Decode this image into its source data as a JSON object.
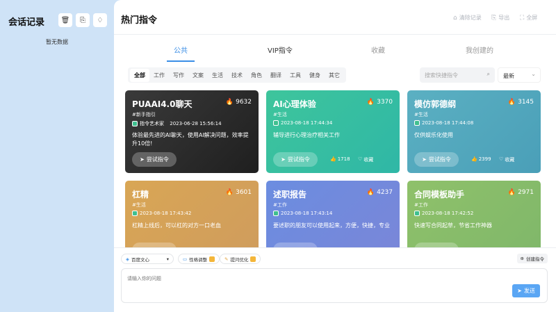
{
  "sidebar": {
    "title": "会话记录",
    "empty": "暂无数据",
    "btn1_icon": "trash-icon",
    "btn2_icon": "export-icon",
    "btn3_icon": "bulb-icon"
  },
  "header": {
    "title": "热门指令",
    "clear": "清除记录",
    "export": "导出",
    "fullscreen": "全屏"
  },
  "tabs": [
    {
      "label": "公共"
    },
    {
      "label": "VIP指令"
    },
    {
      "label": "收藏"
    },
    {
      "label": "我创建的"
    }
  ],
  "filters": [
    "全部",
    "工作",
    "写作",
    "文案",
    "生活",
    "技术",
    "角色",
    "翻译",
    "工具",
    "健身",
    "其它"
  ],
  "search": {
    "placeholder": "搜索快捷指令"
  },
  "sort": {
    "value": "最新"
  },
  "cards": [
    {
      "title": "PUAAI4.0聊天",
      "views": "9632",
      "tag": "#新手指引",
      "author": "指令艺术家",
      "date": "2023-06-28 15:56:14",
      "desc": "体验最先进的AI聊天，使用AI解决问题，效率提升10倍!",
      "try": "尝试指令",
      "likes": "",
      "fav": ""
    },
    {
      "title": "AI心理体验",
      "views": "3370",
      "tag": "#生活",
      "author": "",
      "date": "2023-08-18 17:44:34",
      "desc": "辅导进行心理治疗相关工作",
      "try": "尝试指令",
      "likes": "1718",
      "fav": "收藏"
    },
    {
      "title": "模仿郭德纲",
      "views": "3145",
      "tag": "#生活",
      "author": "",
      "date": "2023-08-18 17:44:08",
      "desc": "仅供娱乐化使用",
      "try": "尝试指令",
      "likes": "2399",
      "fav": "收藏"
    },
    {
      "title": "杠精",
      "views": "3601",
      "tag": "#生活",
      "author": "",
      "date": "2023-08-18 17:43:42",
      "desc": "杠精上线后，可以杠的对方一口老血",
      "try": "",
      "likes": "",
      "fav": ""
    },
    {
      "title": "述职报告",
      "views": "4237",
      "tag": "#工作",
      "author": "",
      "date": "2023-08-18 17:43:14",
      "desc": "要述职的朋友可以使用起来，方便，快捷，专业",
      "try": "",
      "likes": "",
      "fav": ""
    },
    {
      "title": "合同模板助手",
      "views": "2971",
      "tag": "#工作",
      "author": "",
      "date": "2023-08-18 17:42:52",
      "desc": "快速写合同起草，节省工作神器",
      "try": "",
      "likes": "",
      "fav": ""
    }
  ],
  "bottom": {
    "model": "百度文心",
    "tool1": "性格调整",
    "tool2": "提问优化",
    "create": "创建指令",
    "input_placeholder": "请输入你的问题",
    "send": "发送"
  },
  "colors": {
    "accent": "#3a8ee6",
    "card1": "#2b2b2b",
    "card2": "#3ec1a0",
    "card3": "#58aebf",
    "card4": "#d5a458",
    "card5": "#6f8fe0",
    "card6": "#8dbf68"
  }
}
